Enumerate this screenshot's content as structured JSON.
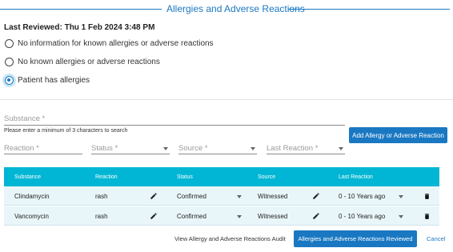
{
  "header": {
    "title": "Allergies and Adverse Reactions",
    "last_reviewed": "Last Reviewed: Thu 1 Feb 2024 3:48 PM"
  },
  "allergy_status": {
    "options": [
      "No information for known allergies or adverse reactions",
      "No known allergies or adverse reactions",
      "Patient has allergies"
    ],
    "selected": "Patient has allergies"
  },
  "add_form": {
    "substance_label": "Substance *",
    "substance_hint": "Please enter a minimum of 3 characters to search",
    "reaction_label": "Reaction *",
    "status_label": "Status *",
    "source_label": "Source *",
    "last_reaction_label": "Last Reaction *",
    "add_button": "Add Allergy or Adverse Reaction"
  },
  "table": {
    "columns": [
      "Substance",
      "Reaction",
      "Status",
      "Source",
      "Last Reaction"
    ],
    "rows": [
      {
        "substance": "Clindamycin",
        "reaction": "rash",
        "status": "Confirmed",
        "source": "Witnessed",
        "last_reaction": "0 - 10 Years ago"
      },
      {
        "substance": "Vancomycin",
        "reaction": "rash",
        "status": "Confirmed",
        "source": "Witnessed",
        "last_reaction": "0 - 10 Years ago"
      }
    ]
  },
  "footer": {
    "audit_link": "View Allergy and Adverse Reactions Audit",
    "reviewed_button": "Allergies and Adverse Reactions Reviewed",
    "cancel_link": "Cancel"
  },
  "icons": {
    "edit": "pencil-icon",
    "delete": "trash-icon",
    "dropdown": "caret-down-icon"
  },
  "colors": {
    "accent": "#1a78c2",
    "table_header": "#00b6d4",
    "row_background": "#e9f6f9"
  }
}
